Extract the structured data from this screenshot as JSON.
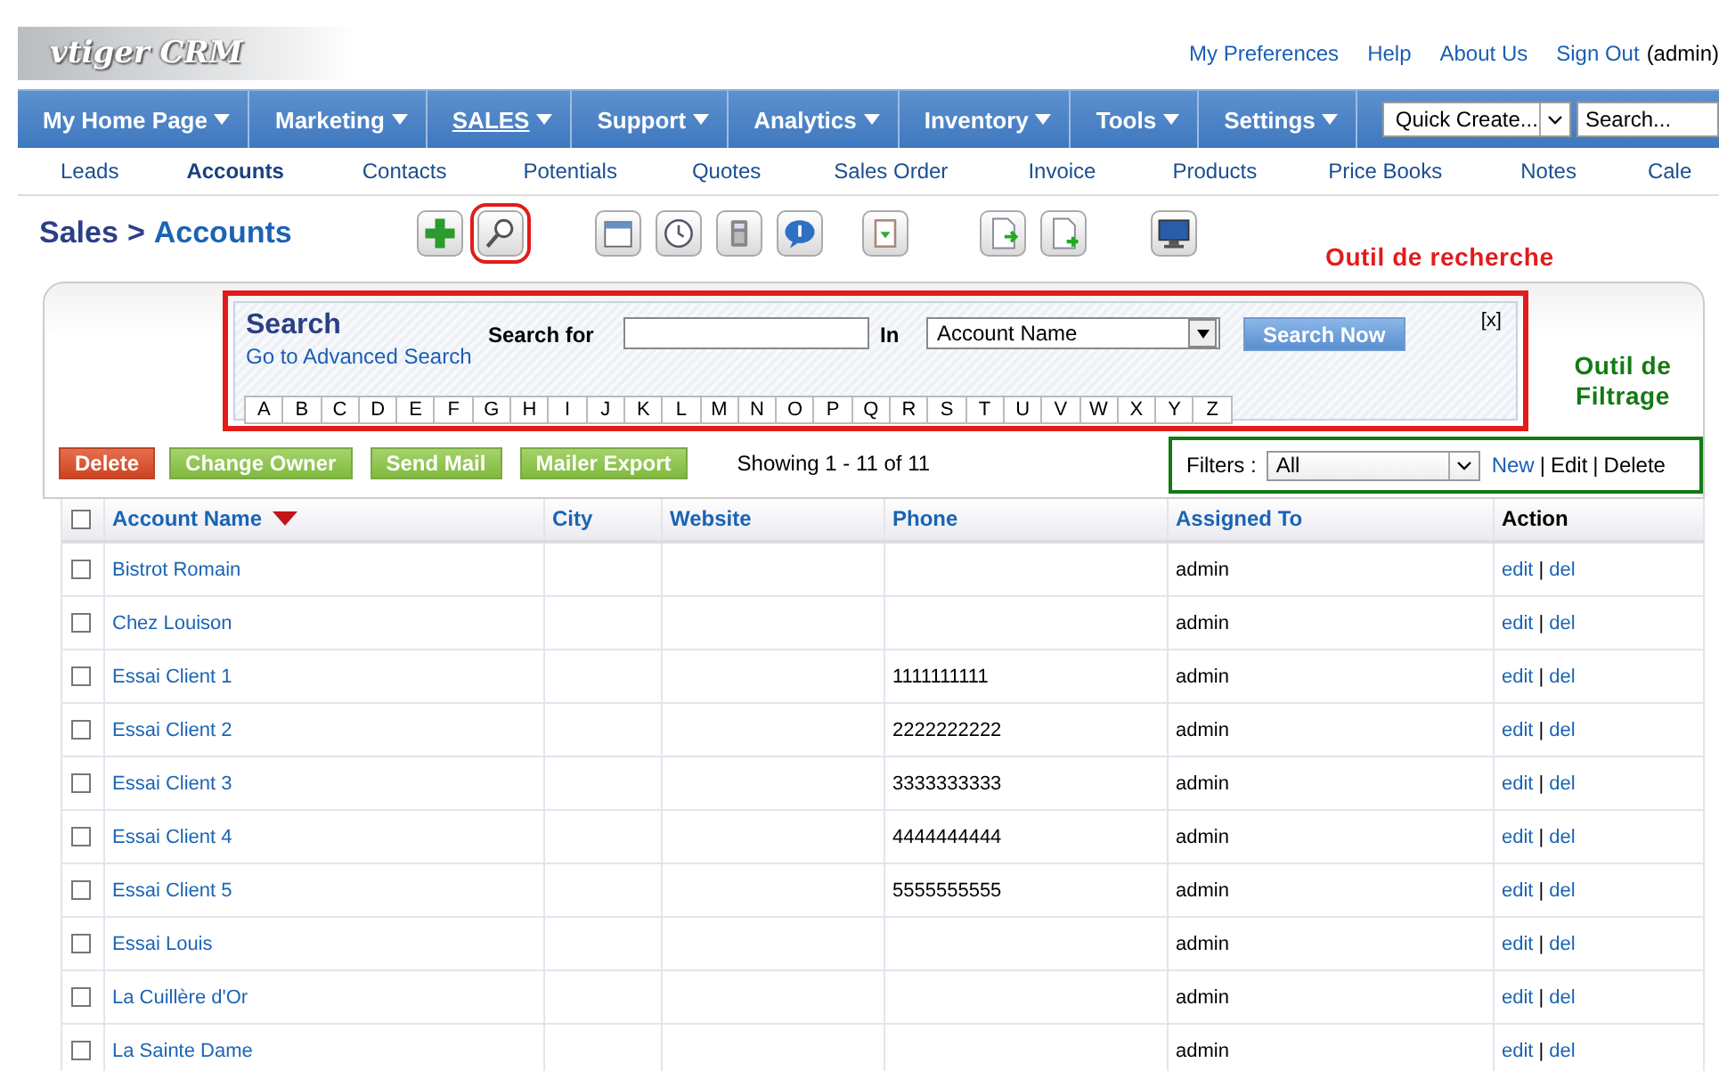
{
  "header": {
    "logo": "vtiger CRM",
    "links": [
      "My Preferences",
      "Help",
      "About Us",
      "Sign Out"
    ],
    "user": "(admin)"
  },
  "nav": {
    "items": [
      {
        "label": "My Home Page",
        "selected": false
      },
      {
        "label": "Marketing",
        "selected": false
      },
      {
        "label": "SALES",
        "selected": true
      },
      {
        "label": "Support",
        "selected": false
      },
      {
        "label": "Analytics",
        "selected": false
      },
      {
        "label": "Inventory",
        "selected": false
      },
      {
        "label": "Tools",
        "selected": false
      },
      {
        "label": "Settings",
        "selected": false
      }
    ],
    "quick_create": "Quick Create...",
    "search": {
      "placeholder": "Search..."
    }
  },
  "subtabs": [
    {
      "label": "Leads",
      "selected": false
    },
    {
      "label": "Accounts",
      "selected": true
    },
    {
      "label": "Contacts",
      "selected": false
    },
    {
      "label": "Potentials",
      "selected": false
    },
    {
      "label": "Quotes",
      "selected": false
    },
    {
      "label": "Sales Order",
      "selected": false
    },
    {
      "label": "Invoice",
      "selected": false
    },
    {
      "label": "Products",
      "selected": false
    },
    {
      "label": "Price Books",
      "selected": false
    },
    {
      "label": "Notes",
      "selected": false
    },
    {
      "label": "Cale",
      "selected": false
    }
  ],
  "breadcrumb": {
    "parent": "Sales",
    "separator": ">",
    "current": "Accounts"
  },
  "toolbar": [
    {
      "kind": "add",
      "highlighted": false
    },
    {
      "kind": "search",
      "highlighted": true
    },
    {
      "kind": "calendar",
      "highlighted": false
    },
    {
      "kind": "clock",
      "highlighted": false
    },
    {
      "kind": "calculator",
      "highlighted": false
    },
    {
      "kind": "chat",
      "highlighted": false
    },
    {
      "kind": "clipboard",
      "highlighted": false
    },
    {
      "kind": "import",
      "highlighted": false
    },
    {
      "kind": "export",
      "highlighted": false
    },
    {
      "kind": "monitor",
      "highlighted": false
    }
  ],
  "annotations": [
    {
      "text": "Outil de recherche",
      "color": "#e31b1b"
    },
    {
      "text": "Outil de Filtrage",
      "color": "#137a13"
    }
  ],
  "search_panel": {
    "highlighted": true,
    "title": "Search",
    "advanced_link": "Go to Advanced Search",
    "search_for": "Search for",
    "in": "In",
    "field": "Account Name",
    "button": "Search Now",
    "close": "[x]",
    "letters": [
      "A",
      "B",
      "C",
      "D",
      "E",
      "F",
      "G",
      "H",
      "I",
      "J",
      "K",
      "L",
      "M",
      "N",
      "O",
      "P",
      "Q",
      "R",
      "S",
      "T",
      "U",
      "V",
      "W",
      "X",
      "Y",
      "Z"
    ]
  },
  "actions": [
    {
      "label": "Delete",
      "kind": "danger"
    },
    {
      "label": "Change Owner",
      "kind": "normal"
    },
    {
      "label": "Send Mail",
      "kind": "normal"
    },
    {
      "label": "Mailer Export",
      "kind": "normal"
    }
  ],
  "showing": "Showing 1 - 11 of 11",
  "filters": {
    "highlighted": true,
    "label": "Filters :",
    "value": "All",
    "links": [
      {
        "label": "New",
        "kind": "link"
      },
      {
        "label": "|",
        "kind": "separator"
      },
      {
        "label": "Edit",
        "kind": "text"
      },
      {
        "label": "|",
        "kind": "separator"
      },
      {
        "label": "Delete",
        "kind": "text"
      }
    ]
  },
  "table": {
    "header_checked": false,
    "columns": [
      {
        "label": "Account Name",
        "sorted": true
      },
      {
        "label": "City",
        "sorted": false
      },
      {
        "label": "Website",
        "sorted": false
      },
      {
        "label": "Phone",
        "sorted": false
      },
      {
        "label": "Assigned To",
        "sorted": false
      },
      {
        "label": "Action",
        "sorted": false
      }
    ],
    "rows": [
      {
        "checked": false,
        "name": "Bistrot Romain",
        "phone": "",
        "assigned": "admin",
        "actions": [
          "edit",
          "|",
          "del"
        ]
      },
      {
        "checked": false,
        "name": "Chez Louison",
        "phone": "",
        "assigned": "admin",
        "actions": [
          "edit",
          "|",
          "del"
        ]
      },
      {
        "checked": false,
        "name": "Essai Client 1",
        "phone": "1111111111",
        "assigned": "admin",
        "actions": [
          "edit",
          "|",
          "del"
        ]
      },
      {
        "checked": false,
        "name": "Essai Client 2",
        "phone": "2222222222",
        "assigned": "admin",
        "actions": [
          "edit",
          "|",
          "del"
        ]
      },
      {
        "checked": false,
        "name": "Essai Client 3",
        "phone": "3333333333",
        "assigned": "admin",
        "actions": [
          "edit",
          "|",
          "del"
        ]
      },
      {
        "checked": false,
        "name": "Essai Client 4",
        "phone": "4444444444",
        "assigned": "admin",
        "actions": [
          "edit",
          "|",
          "del"
        ]
      },
      {
        "checked": false,
        "name": "Essai Client 5",
        "phone": "5555555555",
        "assigned": "admin",
        "actions": [
          "edit",
          "|",
          "del"
        ]
      },
      {
        "checked": false,
        "name": "Essai Louis",
        "phone": "",
        "assigned": "admin",
        "actions": [
          "edit",
          "|",
          "del"
        ]
      },
      {
        "checked": false,
        "name": "La Cuillère d'Or",
        "phone": "",
        "assigned": "admin",
        "actions": [
          "edit",
          "|",
          "del"
        ]
      },
      {
        "checked": false,
        "name": "La Sainte Dame",
        "phone": "",
        "assigned": "admin",
        "actions": [
          "edit",
          "|",
          "del"
        ]
      }
    ]
  }
}
